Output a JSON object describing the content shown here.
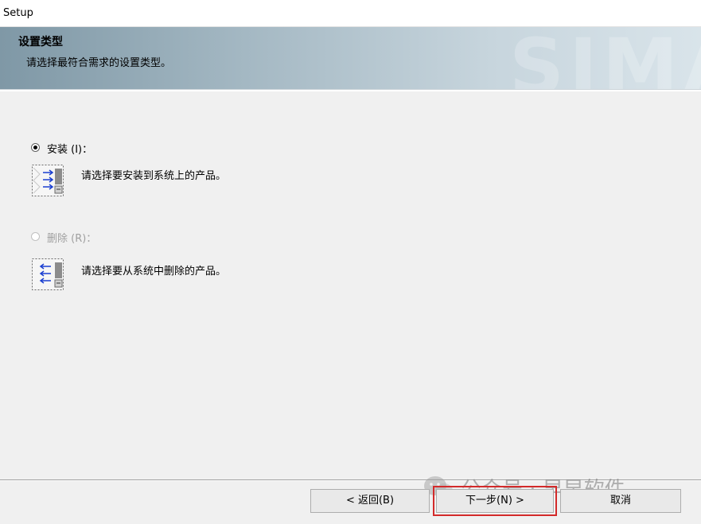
{
  "window": {
    "title": "Setup"
  },
  "banner": {
    "wordmark": "SIMA",
    "heading": "设置类型",
    "subheading": "请选择最符合需求的设置类型。"
  },
  "options": [
    {
      "label": "安装 (I)：",
      "description": "请选择要安装到系统上的产品。",
      "selected": true,
      "enabled": true,
      "icon": "install-arrows-icon"
    },
    {
      "label": "删除 (R)：",
      "description": "请选择要从系统中删除的产品。",
      "selected": false,
      "enabled": false,
      "icon": "remove-arrows-icon"
    }
  ],
  "buttons": {
    "back": "< 返回(B)",
    "next": "下一步(N) >",
    "cancel": "取消"
  },
  "overlay": {
    "watermark_text": "公众号 · 早早软件"
  },
  "colors": {
    "focus_outline": "#d32a2a",
    "banner_dark": "#7f98a6",
    "banner_light": "#d9e4ea",
    "arrow_blue": "#1a3fd1"
  }
}
